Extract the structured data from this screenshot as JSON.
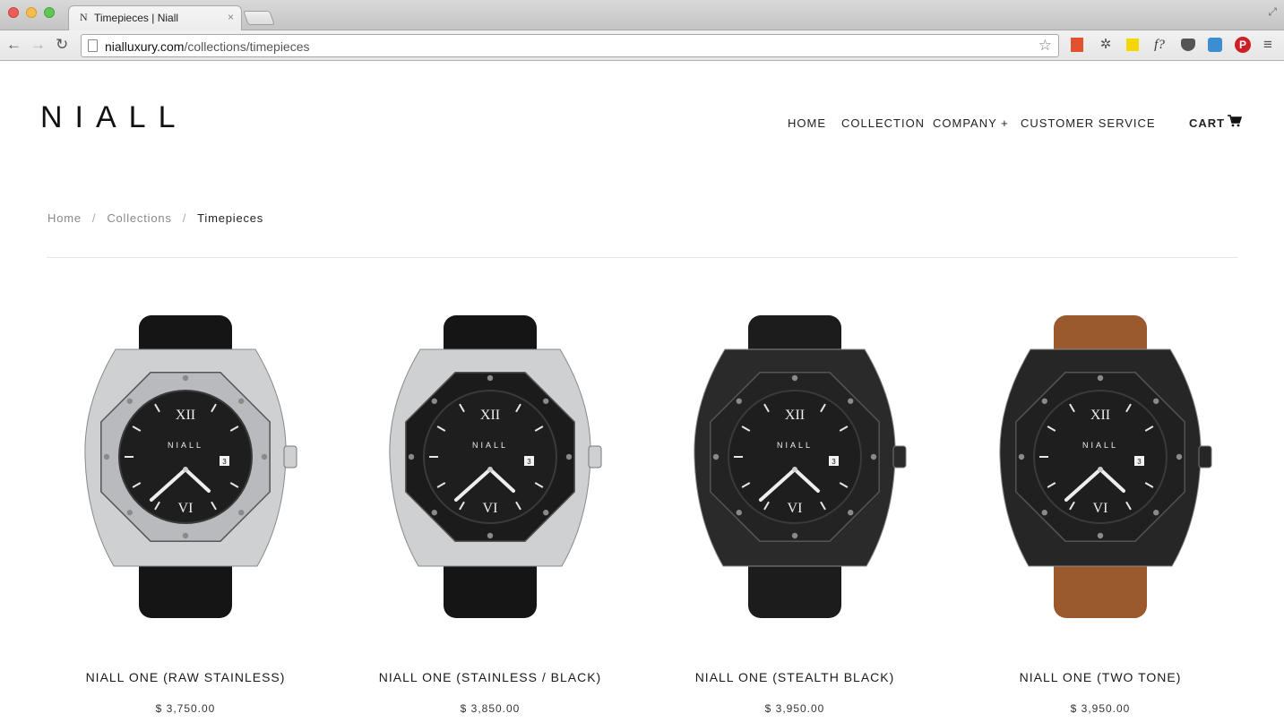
{
  "browser": {
    "tab_title": "Timepieces | Niall",
    "tab_favicon": "N",
    "tab_close": "×",
    "url_host": "nialluxury.com",
    "url_path": "/collections/timepieces"
  },
  "site": {
    "logo": "NIALL",
    "nav": {
      "home": "HOME",
      "collection": "COLLECTION",
      "company": "COMPANY +",
      "service": "CUSTOMER SERVICE",
      "cart": "CART"
    }
  },
  "breadcrumb": {
    "home": "Home",
    "collections": "Collections",
    "current": "Timepieces",
    "separator": "/"
  },
  "products": [
    {
      "name": "NIALL ONE (RAW STAINLESS)",
      "price": "$ 3,750.00",
      "case_color": "#cfd0d2",
      "bezel_color": "#b9babd",
      "strap_color": "#151515"
    },
    {
      "name": "NIALL ONE (STAINLESS / BLACK)",
      "price": "$ 3,850.00",
      "case_color": "#cfd0d2",
      "bezel_color": "#1b1b1b",
      "strap_color": "#151515"
    },
    {
      "name": "NIALL ONE (STEALTH BLACK)",
      "price": "$ 3,950.00",
      "case_color": "#2a2a2a",
      "bezel_color": "#232323",
      "strap_color": "#1c1c1c"
    },
    {
      "name": "NIALL ONE (TWO TONE)",
      "price": "$ 3,950.00",
      "case_color": "#262626",
      "bezel_color": "#202020",
      "strap_color": "#9a5a2e"
    }
  ],
  "watch_face": {
    "brand": "NIALL",
    "numeral_top": "XII",
    "numeral_bottom": "VI",
    "date": "3"
  }
}
